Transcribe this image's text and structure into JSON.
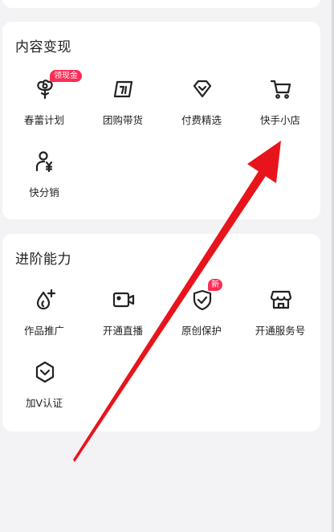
{
  "sections": [
    {
      "title": "内容变现",
      "items": [
        {
          "label": "春蕾计划",
          "icon": "bud-plan-icon",
          "badge": "领现金"
        },
        {
          "label": "团购带货",
          "icon": "group-buy-icon"
        },
        {
          "label": "付费精选",
          "icon": "paid-selection-icon"
        },
        {
          "label": "快手小店",
          "icon": "shopping-cart-icon"
        },
        {
          "label": "快分销",
          "icon": "distribution-icon"
        }
      ]
    },
    {
      "title": "进阶能力",
      "items": [
        {
          "label": "作品推广",
          "icon": "promote-icon"
        },
        {
          "label": "开通直播",
          "icon": "live-camera-icon"
        },
        {
          "label": "原创保护",
          "icon": "shield-check-icon",
          "badge": "新"
        },
        {
          "label": "开通服务号",
          "icon": "store-icon"
        },
        {
          "label": "加V认证",
          "icon": "verify-v-icon"
        }
      ]
    }
  ],
  "colors": {
    "badge": "#fe2c55",
    "arrow": "#e8141c"
  }
}
